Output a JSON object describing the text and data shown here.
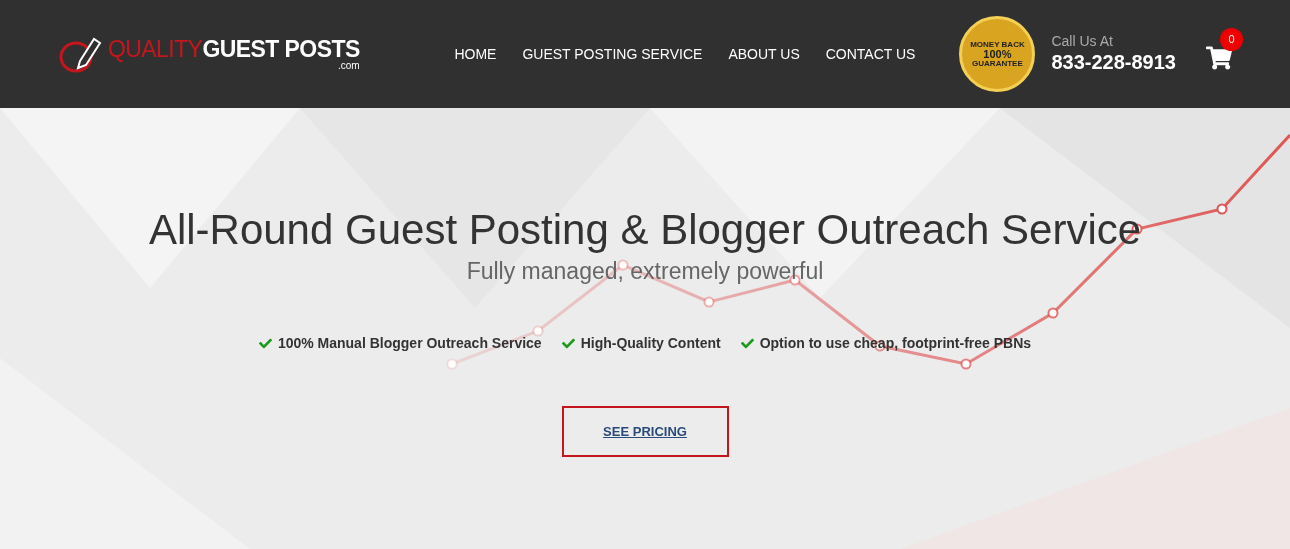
{
  "header": {
    "logo": {
      "word_1": "QUALITY",
      "word_2": "GUEST POSTS",
      "suffix": ".com"
    },
    "nav": [
      "HOME",
      "GUEST POSTING SERVICE",
      "ABOUT US",
      "CONTACT US"
    ],
    "badge": {
      "top": "MONEY BACK",
      "middle": "100%",
      "bottom": "GUARANTEE"
    },
    "call_label": "Call Us At",
    "phone": "833-228-8913",
    "cart_count": "0"
  },
  "hero": {
    "title": "All-Round Guest Posting & Blogger Outreach Service",
    "subtitle": "Fully managed, extremely powerful",
    "features": [
      "100% Manual Blogger Outreach Service",
      "High-Quality Content",
      "Option to use cheap, footprint-free PBNs"
    ],
    "button": "SEE PRICING"
  }
}
